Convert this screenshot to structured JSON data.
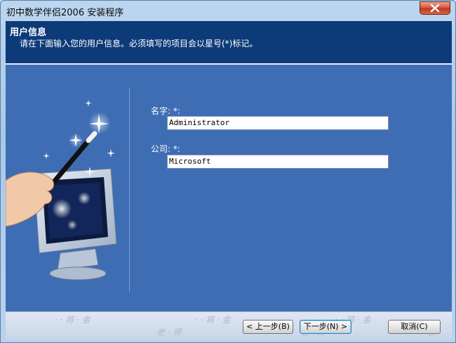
{
  "window": {
    "title": "初中数学伴侣2006 安装程序"
  },
  "header": {
    "title": "用户信息",
    "subtitle": "请在下面输入您的用户信息。必须填写的项目会以星号(*)标记。"
  },
  "form": {
    "name_label": "名字: *:",
    "name_value": "Administrator",
    "company_label": "公司: *:",
    "company_value": "Microsoft"
  },
  "footer": {
    "back_label": "< 上一步(B)",
    "next_label": "下一步(N) >",
    "cancel_label": "取消(C)"
  },
  "colors": {
    "panel_blue": "#3e6db3",
    "header_navy": "#0d3a78",
    "close_red": "#c1371b"
  },
  "icons": [
    "close-icon",
    "wizard-illustration"
  ]
}
